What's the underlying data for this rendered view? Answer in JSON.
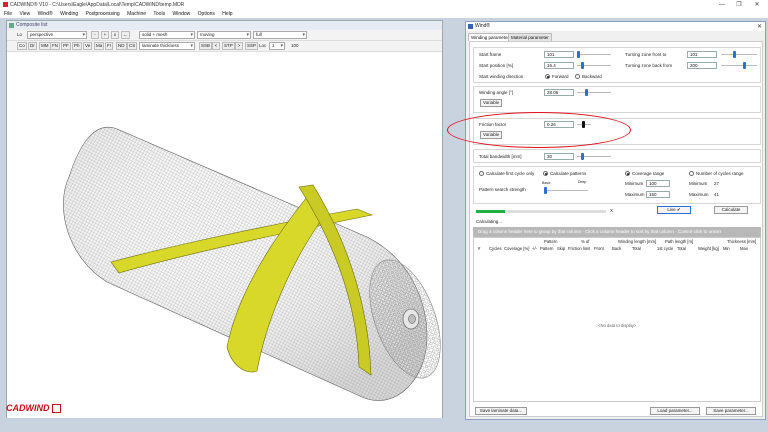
{
  "window": {
    "title": "CADWIND® V10 - C:\\Users\\Eagle\\AppData\\Local\\Temp\\CADWIND\\temp.MDR",
    "min_icon": "—",
    "max_icon": "❐",
    "close_icon": "✕"
  },
  "menu": [
    "File",
    "View",
    "Wind®",
    "Winding",
    "Postprocessing",
    "Machine",
    "Tools",
    "Window",
    "Options",
    "Help"
  ],
  "view_window": {
    "title": "Composite list",
    "toolbar1": {
      "lo_label": "Lo",
      "view_select": "perspective",
      "minus": "-",
      "plus": "+",
      "x": "x",
      "arrow": "←",
      "render_select": "solid + mesh",
      "moving_select": "moving",
      "full_select": "full"
    },
    "toolbar2": {
      "buttons": [
        "Co",
        "Dr",
        "MM",
        "FN",
        "PF",
        "Ph",
        "Ve",
        "Ma",
        "FI",
        "ND",
        "CS"
      ],
      "thickness_select": "laminate thickness",
      "ssb": "SSB",
      "lt": "<",
      "stp": "STP",
      "gt": ">",
      "ssp": "SSP",
      "loc_label": "Loc",
      "loc_value": "1",
      "pct": "100"
    },
    "logo": "CADWIND"
  },
  "dialog": {
    "title": "Wind®",
    "close": "✕",
    "tabs": [
      "Winding parameter",
      "Material parameter"
    ],
    "start_frame_label": "Start frame",
    "start_frame_value": "101",
    "start_position_label": "Start position [%]",
    "start_position_value": "16.4",
    "start_direction_label": "Start winding direction",
    "forward_label": "Forward",
    "backward_label": "Backward",
    "turn_front_label": "Turning zone front to",
    "turn_front_value": "101",
    "turn_back_label": "Turning zone back from",
    "turn_back_value": "200",
    "winding_angle_label": "Winding angle [°]",
    "winding_angle_value": "28.06",
    "variable_label": "Variable",
    "friction_label": "Friction factor",
    "friction_value": "0.26",
    "total_bandwidth_label": "Total bandwidth [mm]",
    "total_bandwidth_value": "30",
    "calc_first_label": "Calculate first cycle only",
    "calc_patterns_label": "Calculate patterns",
    "pattern_strength_label": "Pattern search strength",
    "basic_label": "Basic",
    "deep_label": "Deep",
    "coverage_range_label": "Coverage range",
    "minimum_label": "Minimum",
    "minimum_value": "100",
    "maximum_label": "Maximum",
    "maximum_value": "150",
    "num_cycles_label": "Number of cycles range",
    "min_cycles_label": "Minimum",
    "min_cycles_value": "27",
    "max_cycles_label": "Maximum",
    "max_cycles_value": "41",
    "progress_label": "X",
    "progress_fraction": 0.22,
    "live_button": "Live ✔",
    "calculate_button": "Calculate",
    "calculating": "Calculating...",
    "group_hint": "Drag a column header here to group by that column · Click a column header to sort by that column · Control click to unsort",
    "col_hdr_top": [
      "Pattern",
      "% of",
      "Winding length [mm]",
      "Path length [m]",
      "Thickness [mm]"
    ],
    "col_hdr": [
      "#",
      "Cycles",
      "Coverage [%]",
      "+/-",
      "Pattern",
      "Skip",
      "Friction limit",
      "Front",
      "Back",
      "Total",
      "1st cycle",
      "Total",
      "Weight [kg]",
      "Min",
      "Max"
    ],
    "no_data": "<No data to display>",
    "save_laminate": "Save laminate data...",
    "load_param": "Load parameter...",
    "save_param": "Save parameter..."
  },
  "colors": {
    "accent": "#2a6fd6",
    "band": "#d7d82a",
    "highlight": "#e0101c",
    "logo": "#c0101a"
  }
}
